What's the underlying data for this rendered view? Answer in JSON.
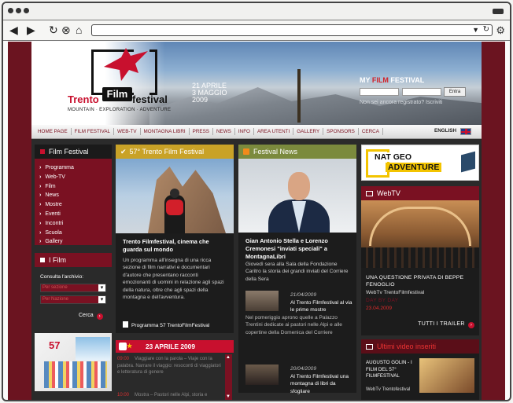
{
  "browser": {
    "back_icon": "back-arrow-icon",
    "forward_icon": "forward-arrow-icon",
    "reload_icon": "reload-icon",
    "stop_icon": "stop-icon",
    "home_icon": "home-icon",
    "settings_icon": "gear-icon"
  },
  "banner": {
    "logo_word_trento": "Trento",
    "logo_word_film": "Film",
    "logo_word_festival": "festival",
    "tagline": "MOUNTAIN · EXPLORATION · ADVENTURE",
    "dates_line1": "21 APRILE",
    "dates_line2": "3 MAGGIO",
    "dates_line3": "2009",
    "my_prefix": "MY",
    "my_mid": "FILM",
    "my_suffix": "FESTIVAL",
    "login_button": "Entra",
    "not_registered": "Non sei ancora registrato? Iscriviti"
  },
  "nav": {
    "items": [
      "HOME PAGE",
      "FILM FESTIVAL",
      "WEB-TV",
      "MONTAGNA LIBRI",
      "PRESS",
      "NEWS",
      "INFO",
      "AREA UTENTI",
      "GALLERY",
      "SPONSORS",
      "CERCA"
    ],
    "language": "ENGLISH"
  },
  "film_festival": {
    "title": "Film Festival",
    "items": [
      "Programma",
      "Web-TV",
      "Film",
      "News",
      "Mostre",
      "Eventi",
      "Incontri",
      "Scuola",
      "Gallery"
    ]
  },
  "i_film": {
    "title": "I Film",
    "archive_label": "Consulta l'archivio:",
    "select_section": "Per sezione",
    "select_nation": "Per Nazione",
    "search_label": "Cerca"
  },
  "promo_57": {
    "number": "57"
  },
  "featured": {
    "header": "57° Trento Film Festival",
    "title": "Trento Filmfestival, cinema che guarda sul mondo",
    "body": "Un programma all'insegna di una ricca sezione di film narrativi e documentari d'autore che presentano racconti emozionanti di uomini in relazione agli spazi della natura, oltre che agli spazi della montagna e dell'avventura.",
    "link": "Programma 57 TrentoFilmFestival"
  },
  "calendar": {
    "date": "23 APRILE 2009",
    "events": [
      {
        "time": "09:00",
        "text": "Viaggiare con la parola – Viaje con la palabra. Narrare il viaggio: resoconti di viaggiatori e letteratura di genere"
      },
      {
        "time": "10:00",
        "text": "Mostra – Pastori nelle Alpi, storia e"
      }
    ]
  },
  "festival_news": {
    "header": "Festival News",
    "lead_title": "Gian Antonio Stella e Lorenzo Cremonesi \"inviati speciali\" a MontagnaLibri",
    "lead_body": "Giovedì sera alla Sala della Fondazione Caritro la storia dei grandi inviati del Corriere della Sera",
    "items": [
      {
        "date": "21/04/2009",
        "title": "Al Trento Filmfestival al via le prime mostre",
        "body": "Nel pomeriggio aprono quelle a Palazzo Trentini dedicate ai pastori nelle Alpi e alle copertine della Domenica del Corriere"
      },
      {
        "date": "20/04/2009",
        "title": "Al Trento Filmfestival una montagna di libri da sfogliare"
      }
    ]
  },
  "natgeo": {
    "line1": "NAT GEO",
    "line2": "ADVENTURE"
  },
  "webtv": {
    "header": "WebTV",
    "title": "UNA QUESTIONE PRIVATA DI BEPPE FENOGLIO",
    "source": "WebTv TrentoFilmfestival",
    "label": "DAY BY DAY",
    "date": "23.04.2009",
    "all_trailers": "TUTTI I TRAILER"
  },
  "latest_videos": {
    "header": "Ultimi video inseriti",
    "title": "AUGUSTO GOLIN - I FILM DEL 57° FILMFESTIVAL",
    "source": "WebTv Trentofestival"
  },
  "colors": {
    "brand_red": "#7a1122",
    "accent_red": "#c8102e",
    "gold": "#c9a227",
    "olive": "#7b8a3d"
  }
}
